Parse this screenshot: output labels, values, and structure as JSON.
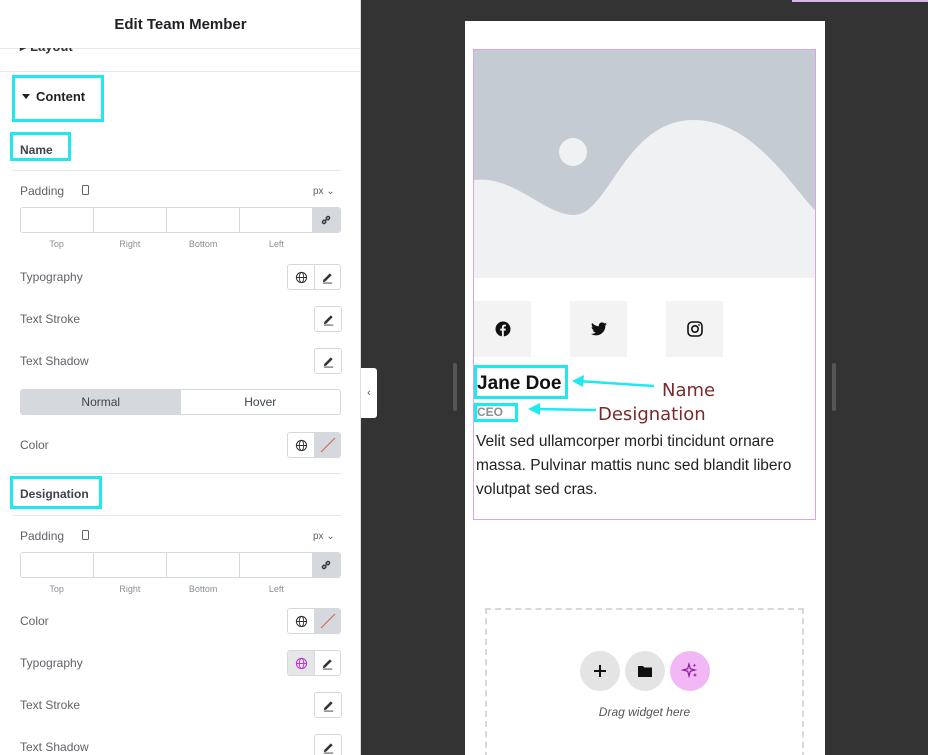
{
  "panel": {
    "title": "Edit Team Member",
    "layout_label": "Layout",
    "content_label": "Content",
    "name_section": {
      "heading": "Name",
      "padding_label": "Padding",
      "unit": "px ⌄",
      "dim_labels": [
        "Top",
        "Right",
        "Bottom",
        "Left"
      ],
      "typography_label": "Typography",
      "text_stroke_label": "Text Stroke",
      "text_shadow_label": "Text Shadow",
      "tab_normal": "Normal",
      "tab_hover": "Hover",
      "color_label": "Color"
    },
    "designation_section": {
      "heading": "Designation",
      "padding_label": "Padding",
      "unit": "px ⌄",
      "dim_labels": [
        "Top",
        "Right",
        "Bottom",
        "Left"
      ],
      "color_label": "Color",
      "typography_label": "Typography",
      "text_stroke_label": "Text Stroke",
      "text_shadow_label": "Text Shadow"
    }
  },
  "preview": {
    "name": "Jane Doe",
    "designation": "CEO",
    "description": "Velit sed ullamcorper morbi tincidunt ornare massa. Pulvinar mattis nunc sed blandit libero volutpat sed cras.",
    "social_icons": [
      "facebook-icon",
      "twitter-icon",
      "instagram-icon"
    ],
    "annotation_name": "Name",
    "annotation_designation": "Designation",
    "drop_label": "Drag widget here"
  },
  "colors": {
    "highlight": "#1ee8f0",
    "annotation": "#7a2a2a",
    "ai_button": "#f1b8f5",
    "widget_border": "#d9a4ec"
  }
}
